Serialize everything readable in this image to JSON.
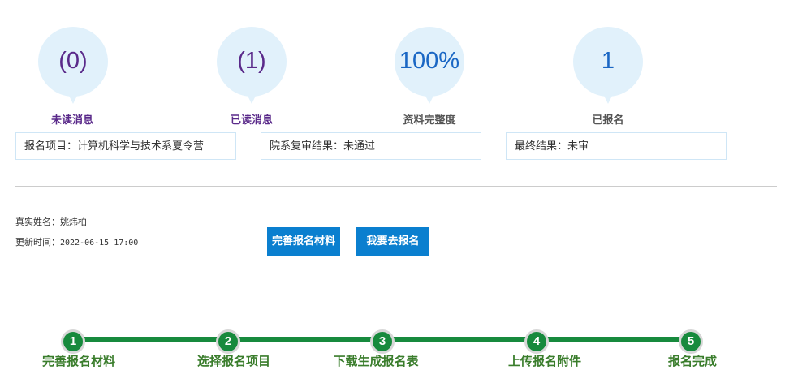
{
  "stats": [
    {
      "value": "(0)",
      "label": "未读消息",
      "value_color": "#5a2a8a",
      "label_color": "#5a2a8a"
    },
    {
      "value": "(1)",
      "label": "已读消息",
      "value_color": "#5a2a8a",
      "label_color": "#5a2a8a"
    },
    {
      "value": "100%",
      "label": "资料完整度",
      "value_color": "#1a67c4",
      "label_color": "#555555"
    },
    {
      "value": "1",
      "label": "已报名",
      "value_color": "#1a67c4",
      "label_color": "#555555"
    }
  ],
  "info_boxes": [
    {
      "text": "报名项目：计算机科学与技术系夏令营"
    },
    {
      "text": "院系复审结果：未通过"
    },
    {
      "text": "最终结果：未审"
    }
  ],
  "meta": {
    "name_label": "真实姓名：",
    "name_value": "姚炜柏",
    "updated_label": "更新时间：",
    "updated_value": "2022-06-15 17:00"
  },
  "buttons": {
    "complete_materials": "完善报名材料",
    "go_apply": "我要去报名"
  },
  "steps": [
    {
      "num": "1",
      "label": "完善报名材料"
    },
    {
      "num": "2",
      "label": "选择报名项目"
    },
    {
      "num": "3",
      "label": "下载生成报名表"
    },
    {
      "num": "4",
      "label": "上传报名附件"
    },
    {
      "num": "5",
      "label": "报名完成"
    }
  ],
  "colors": {
    "accent": "#0a7fcf",
    "progress": "#178a3d",
    "step_label": "#3a7d2c",
    "bubble": "#e1f1fb"
  }
}
